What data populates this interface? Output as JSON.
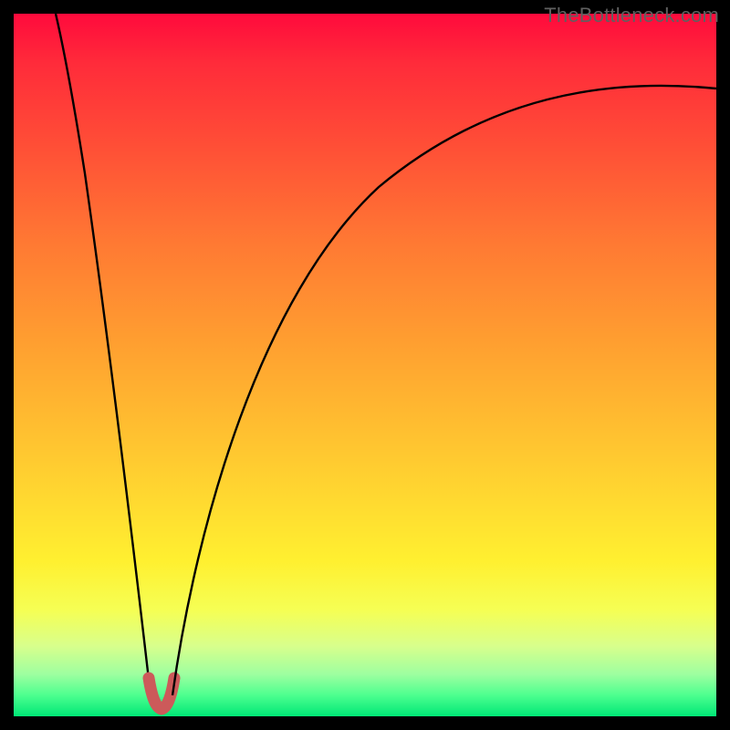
{
  "watermark": "TheBottleneck.com",
  "chart_data": {
    "type": "line",
    "title": "",
    "xlabel": "",
    "ylabel": "",
    "xlim": [
      0,
      100
    ],
    "ylim": [
      0,
      100
    ],
    "gradient_stops": [
      {
        "pos": 0.0,
        "color": "#ff0a3c"
      },
      {
        "pos": 0.07,
        "color": "#ff2b3a"
      },
      {
        "pos": 0.2,
        "color": "#ff5236"
      },
      {
        "pos": 0.33,
        "color": "#ff7a33"
      },
      {
        "pos": 0.48,
        "color": "#ffa230"
      },
      {
        "pos": 0.63,
        "color": "#ffc930"
      },
      {
        "pos": 0.78,
        "color": "#fff030"
      },
      {
        "pos": 0.85,
        "color": "#f5ff55"
      },
      {
        "pos": 0.9,
        "color": "#d8ff8c"
      },
      {
        "pos": 0.94,
        "color": "#9effa0"
      },
      {
        "pos": 0.97,
        "color": "#4dff8f"
      },
      {
        "pos": 1.0,
        "color": "#00e876"
      }
    ],
    "series": [
      {
        "name": "curve-left",
        "color": "#000000",
        "x": [
          6.0,
          8.0,
          10.0,
          12.0,
          14.0,
          16.0,
          18.0,
          19.5
        ],
        "y": [
          100.0,
          85.0,
          70.0,
          55.0,
          40.0,
          25.0,
          10.0,
          3.0
        ]
      },
      {
        "name": "curve-right",
        "color": "#000000",
        "x": [
          22.5,
          24.0,
          27.0,
          31.0,
          36.0,
          42.0,
          49.0,
          57.0,
          66.0,
          76.0,
          87.0,
          100.0
        ],
        "y": [
          3.0,
          12.0,
          25.0,
          39.0,
          51.0,
          61.0,
          69.5,
          76.0,
          81.0,
          84.7,
          87.3,
          89.0
        ]
      },
      {
        "name": "dip-marker",
        "color": "#cc5a5a",
        "x": [
          19.0,
          19.5,
          20.0,
          20.5,
          21.0,
          21.5,
          22.0,
          22.5,
          23.0
        ],
        "y": [
          4.0,
          2.5,
          1.6,
          1.2,
          1.0,
          1.2,
          1.6,
          2.5,
          4.0
        ]
      }
    ],
    "dip": {
      "x": 21.0,
      "y": 1.0
    }
  }
}
